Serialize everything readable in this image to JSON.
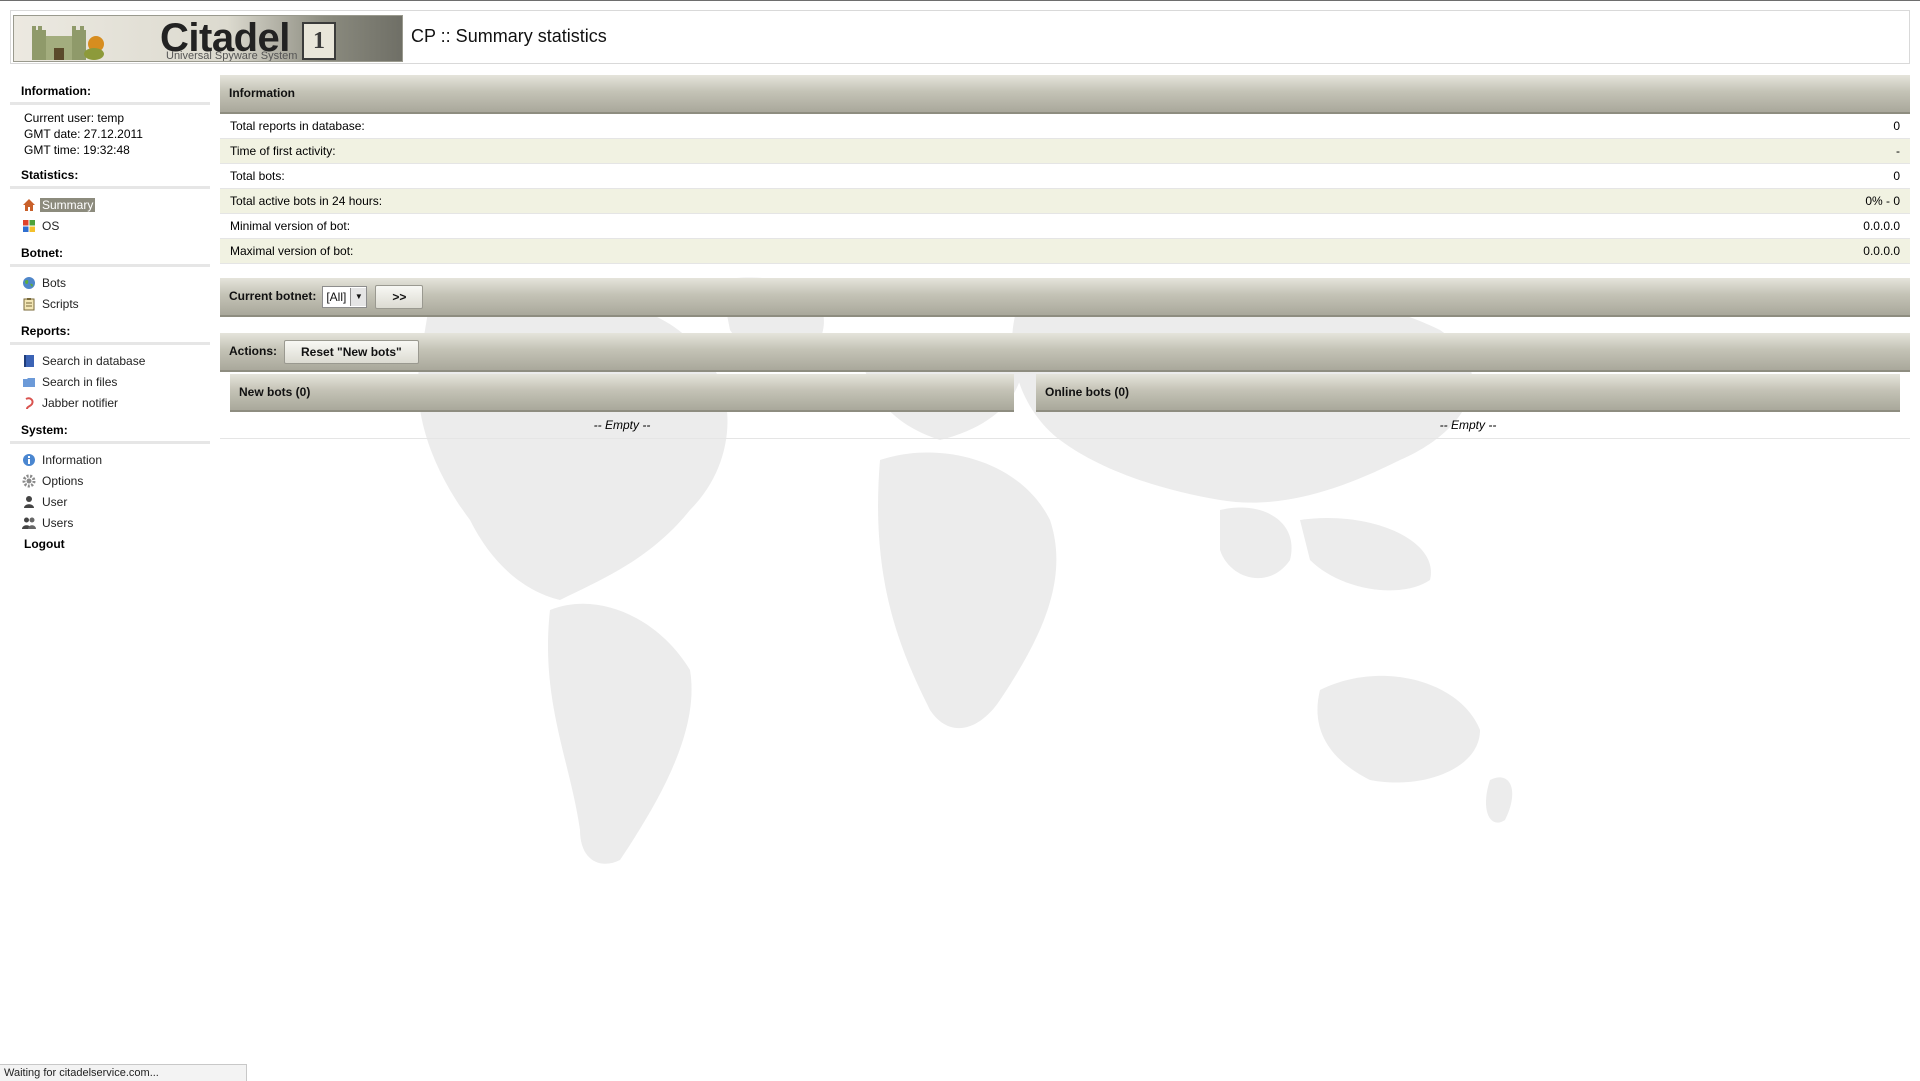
{
  "header": {
    "logo_text": "Citadel",
    "logo_badge": "1",
    "logo_subtitle": "Universal Spyware System",
    "page_title": "CP :: Summary statistics"
  },
  "sidebar": {
    "information": {
      "heading": "Information:",
      "current_user": "Current user: temp",
      "gmt_date": "GMT date: 27.12.2011",
      "gmt_time": "GMT time: 19:32:48"
    },
    "statistics": {
      "heading": "Statistics:",
      "items": [
        {
          "label": "Summary",
          "icon": "home-icon",
          "active": true
        },
        {
          "label": "OS",
          "icon": "windows-icon"
        }
      ]
    },
    "botnet": {
      "heading": "Botnet:",
      "items": [
        {
          "label": "Bots",
          "icon": "globe-icon"
        },
        {
          "label": "Scripts",
          "icon": "clipboard-icon"
        }
      ]
    },
    "reports": {
      "heading": "Reports:",
      "items": [
        {
          "label": "Search in database",
          "icon": "book-icon"
        },
        {
          "label": "Search in files",
          "icon": "folder-icon"
        },
        {
          "label": "Jabber notifier",
          "icon": "jabber-icon"
        }
      ]
    },
    "system": {
      "heading": "System:",
      "items": [
        {
          "label": "Information",
          "icon": "info-icon"
        },
        {
          "label": "Options",
          "icon": "gear-icon"
        },
        {
          "label": "User",
          "icon": "user-icon"
        },
        {
          "label": "Users",
          "icon": "users-icon"
        }
      ]
    },
    "logout": "Logout"
  },
  "main": {
    "info_panel": {
      "title": "Information",
      "rows": [
        {
          "label": "Total reports in database:",
          "value": "0"
        },
        {
          "label": "Time of first activity:",
          "value": "-"
        },
        {
          "label": "Total bots:",
          "value": "0"
        },
        {
          "label": "Total active bots in 24 hours:",
          "value": "0% - 0"
        },
        {
          "label": "Minimal version of bot:",
          "value": "0.0.0.0"
        },
        {
          "label": "Maximal version of bot:",
          "value": "0.0.0.0"
        }
      ]
    },
    "botnet_bar": {
      "label": "Current botnet:",
      "selected": "[All]",
      "go_button": ">>"
    },
    "actions_bar": {
      "label": "Actions:",
      "reset_button": "Reset \"New bots\""
    },
    "new_bots": {
      "title": "New bots (0)",
      "empty": "-- Empty --"
    },
    "online_bots": {
      "title": "Online bots (0)",
      "empty": "-- Empty --"
    }
  },
  "statusbar": {
    "text": "Waiting for citadelservice.com..."
  },
  "colors": {
    "bar_dark": "#a9a89b",
    "row_alt": "#f1f2e2",
    "active_item": "#8c8b7d",
    "map": "#ececec"
  }
}
